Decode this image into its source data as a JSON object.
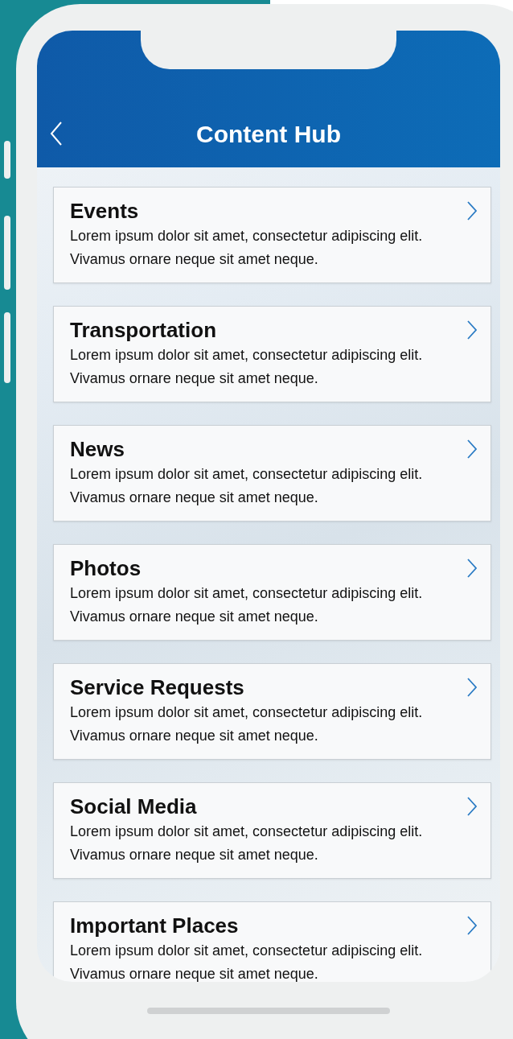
{
  "header": {
    "title": "Content Hub"
  },
  "items": [
    {
      "title": "Events",
      "description": "Lorem ipsum dolor sit amet, consectetur adipiscing elit. Vivamus ornare neque sit amet neque."
    },
    {
      "title": "Transportation",
      "description": "Lorem ipsum dolor sit amet, consectetur adipiscing elit. Vivamus ornare neque sit amet neque."
    },
    {
      "title": "News",
      "description": "Lorem ipsum dolor sit amet, consectetur adipiscing elit. Vivamus ornare neque sit amet neque."
    },
    {
      "title": "Photos",
      "description": "Lorem ipsum dolor sit amet, consectetur adipiscing elit. Vivamus ornare neque sit amet neque."
    },
    {
      "title": "Service Requests",
      "description": "Lorem ipsum dolor sit amet, consectetur adipiscing elit. Vivamus ornare neque sit amet neque."
    },
    {
      "title": "Social Media",
      "description": "Lorem ipsum dolor sit amet, consectetur adipiscing elit. Vivamus ornare neque sit amet neque."
    },
    {
      "title": "Important Places",
      "description": "Lorem ipsum dolor sit amet, consectetur adipiscing elit. Vivamus ornare neque sit amet neque."
    }
  ]
}
